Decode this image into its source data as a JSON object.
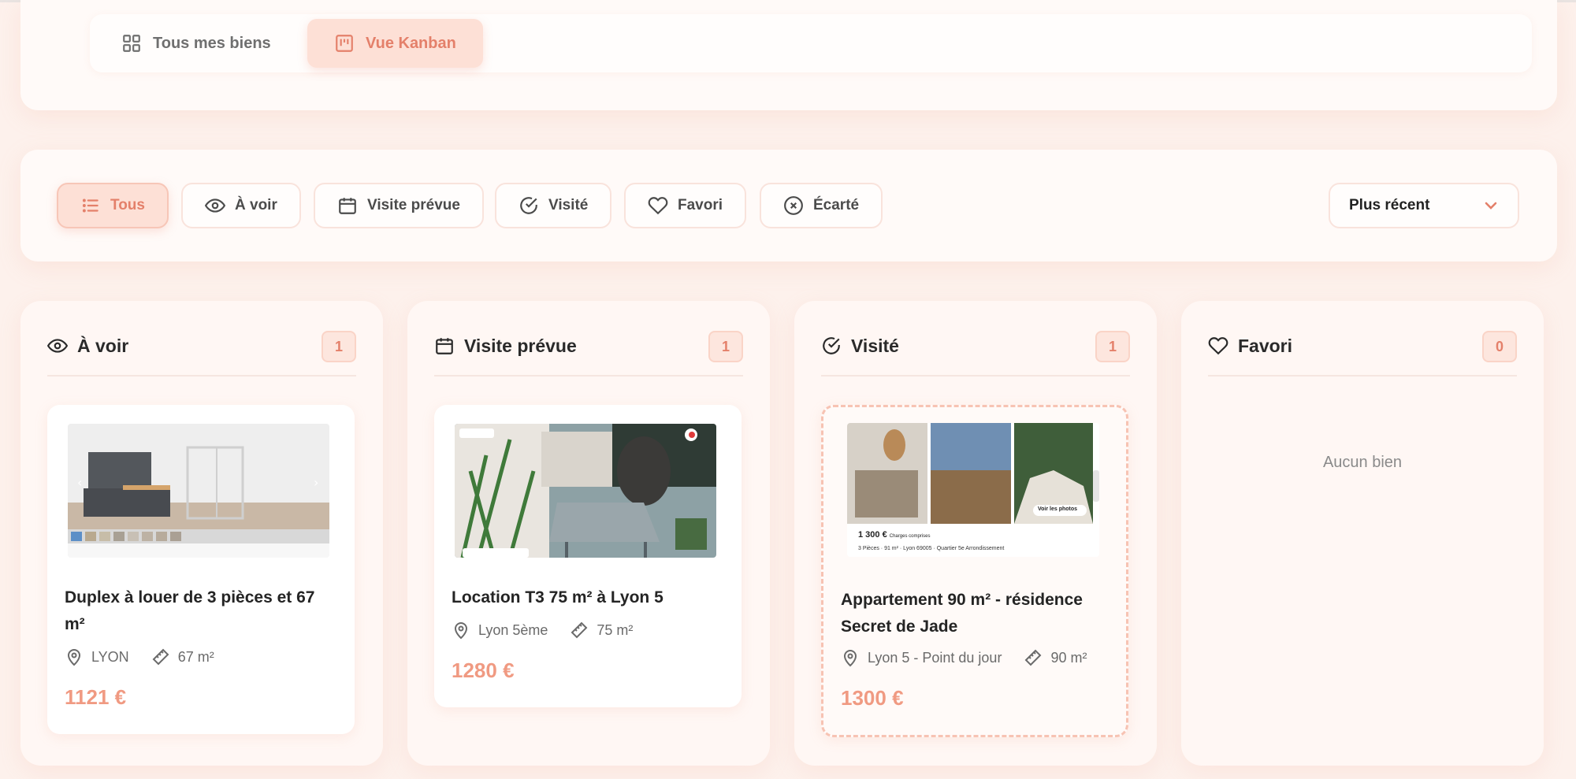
{
  "views": {
    "all_label": "Tous mes biens",
    "kanban_label": "Vue Kanban",
    "active": "kanban"
  },
  "filters": [
    {
      "label": "Tous",
      "icon": "list-icon",
      "active": true
    },
    {
      "label": "À voir",
      "icon": "eye-icon",
      "active": false
    },
    {
      "label": "Visite prévue",
      "icon": "calendar-icon",
      "active": false
    },
    {
      "label": "Visité",
      "icon": "check-circle-icon",
      "active": false
    },
    {
      "label": "Favori",
      "icon": "heart-icon",
      "active": false
    },
    {
      "label": "Écarté",
      "icon": "x-circle-icon",
      "active": false
    }
  ],
  "sort": {
    "selected": "Plus récent"
  },
  "columns": [
    {
      "title": "À voir",
      "icon": "eye-icon",
      "count": "1",
      "card": {
        "title": "Duplex à louer de 3 pièces et 67 m²",
        "location": "LYON",
        "area": "67 m²",
        "price": "1121 €"
      }
    },
    {
      "title": "Visite prévue",
      "icon": "calendar-icon",
      "count": "1",
      "card": {
        "title": "Location T3 75 m² à Lyon 5",
        "location": "Lyon 5ème",
        "area": "75 m²",
        "price": "1280 €"
      }
    },
    {
      "title": "Visité",
      "icon": "check-circle-icon",
      "count": "1",
      "card": {
        "title": "Appartement 90 m² - résidence Secret de Jade",
        "location": "Lyon 5 - Point du jour",
        "area": "90 m²",
        "price": "1300 €",
        "thumb_price": "1 300 €",
        "thumb_charges": "Charges comprises",
        "thumb_desc": "3 Pièces · 91 m² · Lyon 69005 · Quartier 5e Arrondissement",
        "thumb_button": "Voir les photos"
      }
    },
    {
      "title": "Favori",
      "icon": "heart-icon",
      "count": "0",
      "empty_text": "Aucun bien"
    }
  ],
  "accent_color": "#e4806a",
  "price_color": "#f09a82"
}
